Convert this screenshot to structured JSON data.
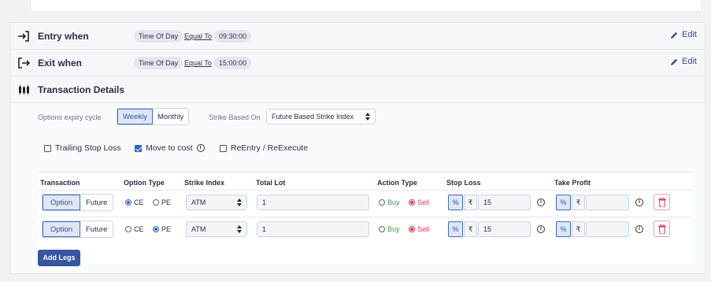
{
  "entry": {
    "title": "Entry when",
    "condition": "Time Of Day",
    "operator": "Equal To",
    "value": "09:30:00",
    "edit_label": "Edit"
  },
  "exit": {
    "title": "Exit when",
    "condition": "Time Of Day",
    "operator": "Equal To",
    "value": "15:00:00",
    "edit_label": "Edit"
  },
  "transaction": {
    "title": "Transaction Details",
    "expiry_label": "Options expiry cycle",
    "expiry_options": [
      "Weekly",
      "Monthly"
    ],
    "expiry_selected": "Weekly",
    "strike_based_label": "Strike Based On",
    "strike_based_value": "Future Based Strike Index",
    "checks": [
      {
        "label": "Trailing Stop Loss",
        "checked": false
      },
      {
        "label": "Move to cost",
        "checked": true
      },
      {
        "label": "ReEntry / ReExecute",
        "checked": false
      }
    ],
    "info_glyph": "i"
  },
  "table": {
    "headers": [
      "Transaction",
      "Option Type",
      "Strike Index",
      "Total Lot",
      "Action Type",
      "Stop Loss",
      "Take Profit"
    ],
    "rows": [
      {
        "txn_opts": [
          "Option",
          "Future"
        ],
        "txn": "Option",
        "opt1": "CE",
        "opt2": "PE",
        "opt_sel": "CE",
        "strike": "ATM",
        "lot": "1",
        "buy": "Buy",
        "sell": "Sell",
        "action": "Sell",
        "sl_pct": "%",
        "sl_rupee": "₹",
        "sl_val": "15",
        "tp_pct": "%",
        "tp_rupee": "₹",
        "tp_val": ""
      },
      {
        "txn_opts": [
          "Option",
          "Future"
        ],
        "txn": "Option",
        "opt1": "CE",
        "opt2": "PE",
        "opt_sel": "PE",
        "strike": "ATM",
        "lot": "1",
        "buy": "Buy",
        "sell": "Sell",
        "action": "Sell",
        "sl_pct": "%",
        "sl_rupee": "₹",
        "sl_val": "15",
        "tp_pct": "%",
        "tp_rupee": "₹",
        "tp_val": ""
      }
    ],
    "add_legs_label": "Add Legs"
  },
  "colors": {
    "accent": "#3656a2",
    "selected": "#2f64c9",
    "sell": "#d9364b",
    "buy": "#3b9a54"
  }
}
